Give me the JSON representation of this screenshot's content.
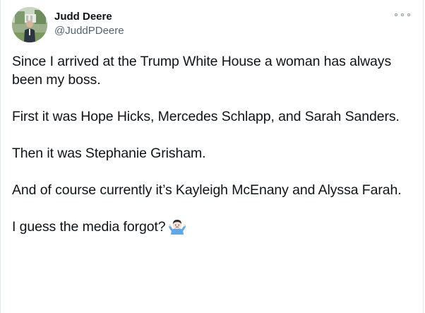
{
  "author": {
    "display_name": "Judd Deere",
    "handle": "@JuddPDeere",
    "avatar_icon": "profile-photo"
  },
  "menu": {
    "icon": "more-options-icon"
  },
  "tweet": {
    "paragraphs": [
      "Since I arrived at the Trump White House a woman has always been my boss.",
      "First it was Hope Hicks, Mercedes Schlapp, and Sarah Sanders.",
      "Then it was Stephanie Grisham.",
      "And of course currently it’s Kayleigh McEnany and Alyssa Farah.",
      "I guess the media forgot?"
    ],
    "trailing_emoji": "man-shrugging-emoji"
  },
  "colors": {
    "text": "#0f1419",
    "secondary": "#536471",
    "border": "#e1e8ed"
  }
}
